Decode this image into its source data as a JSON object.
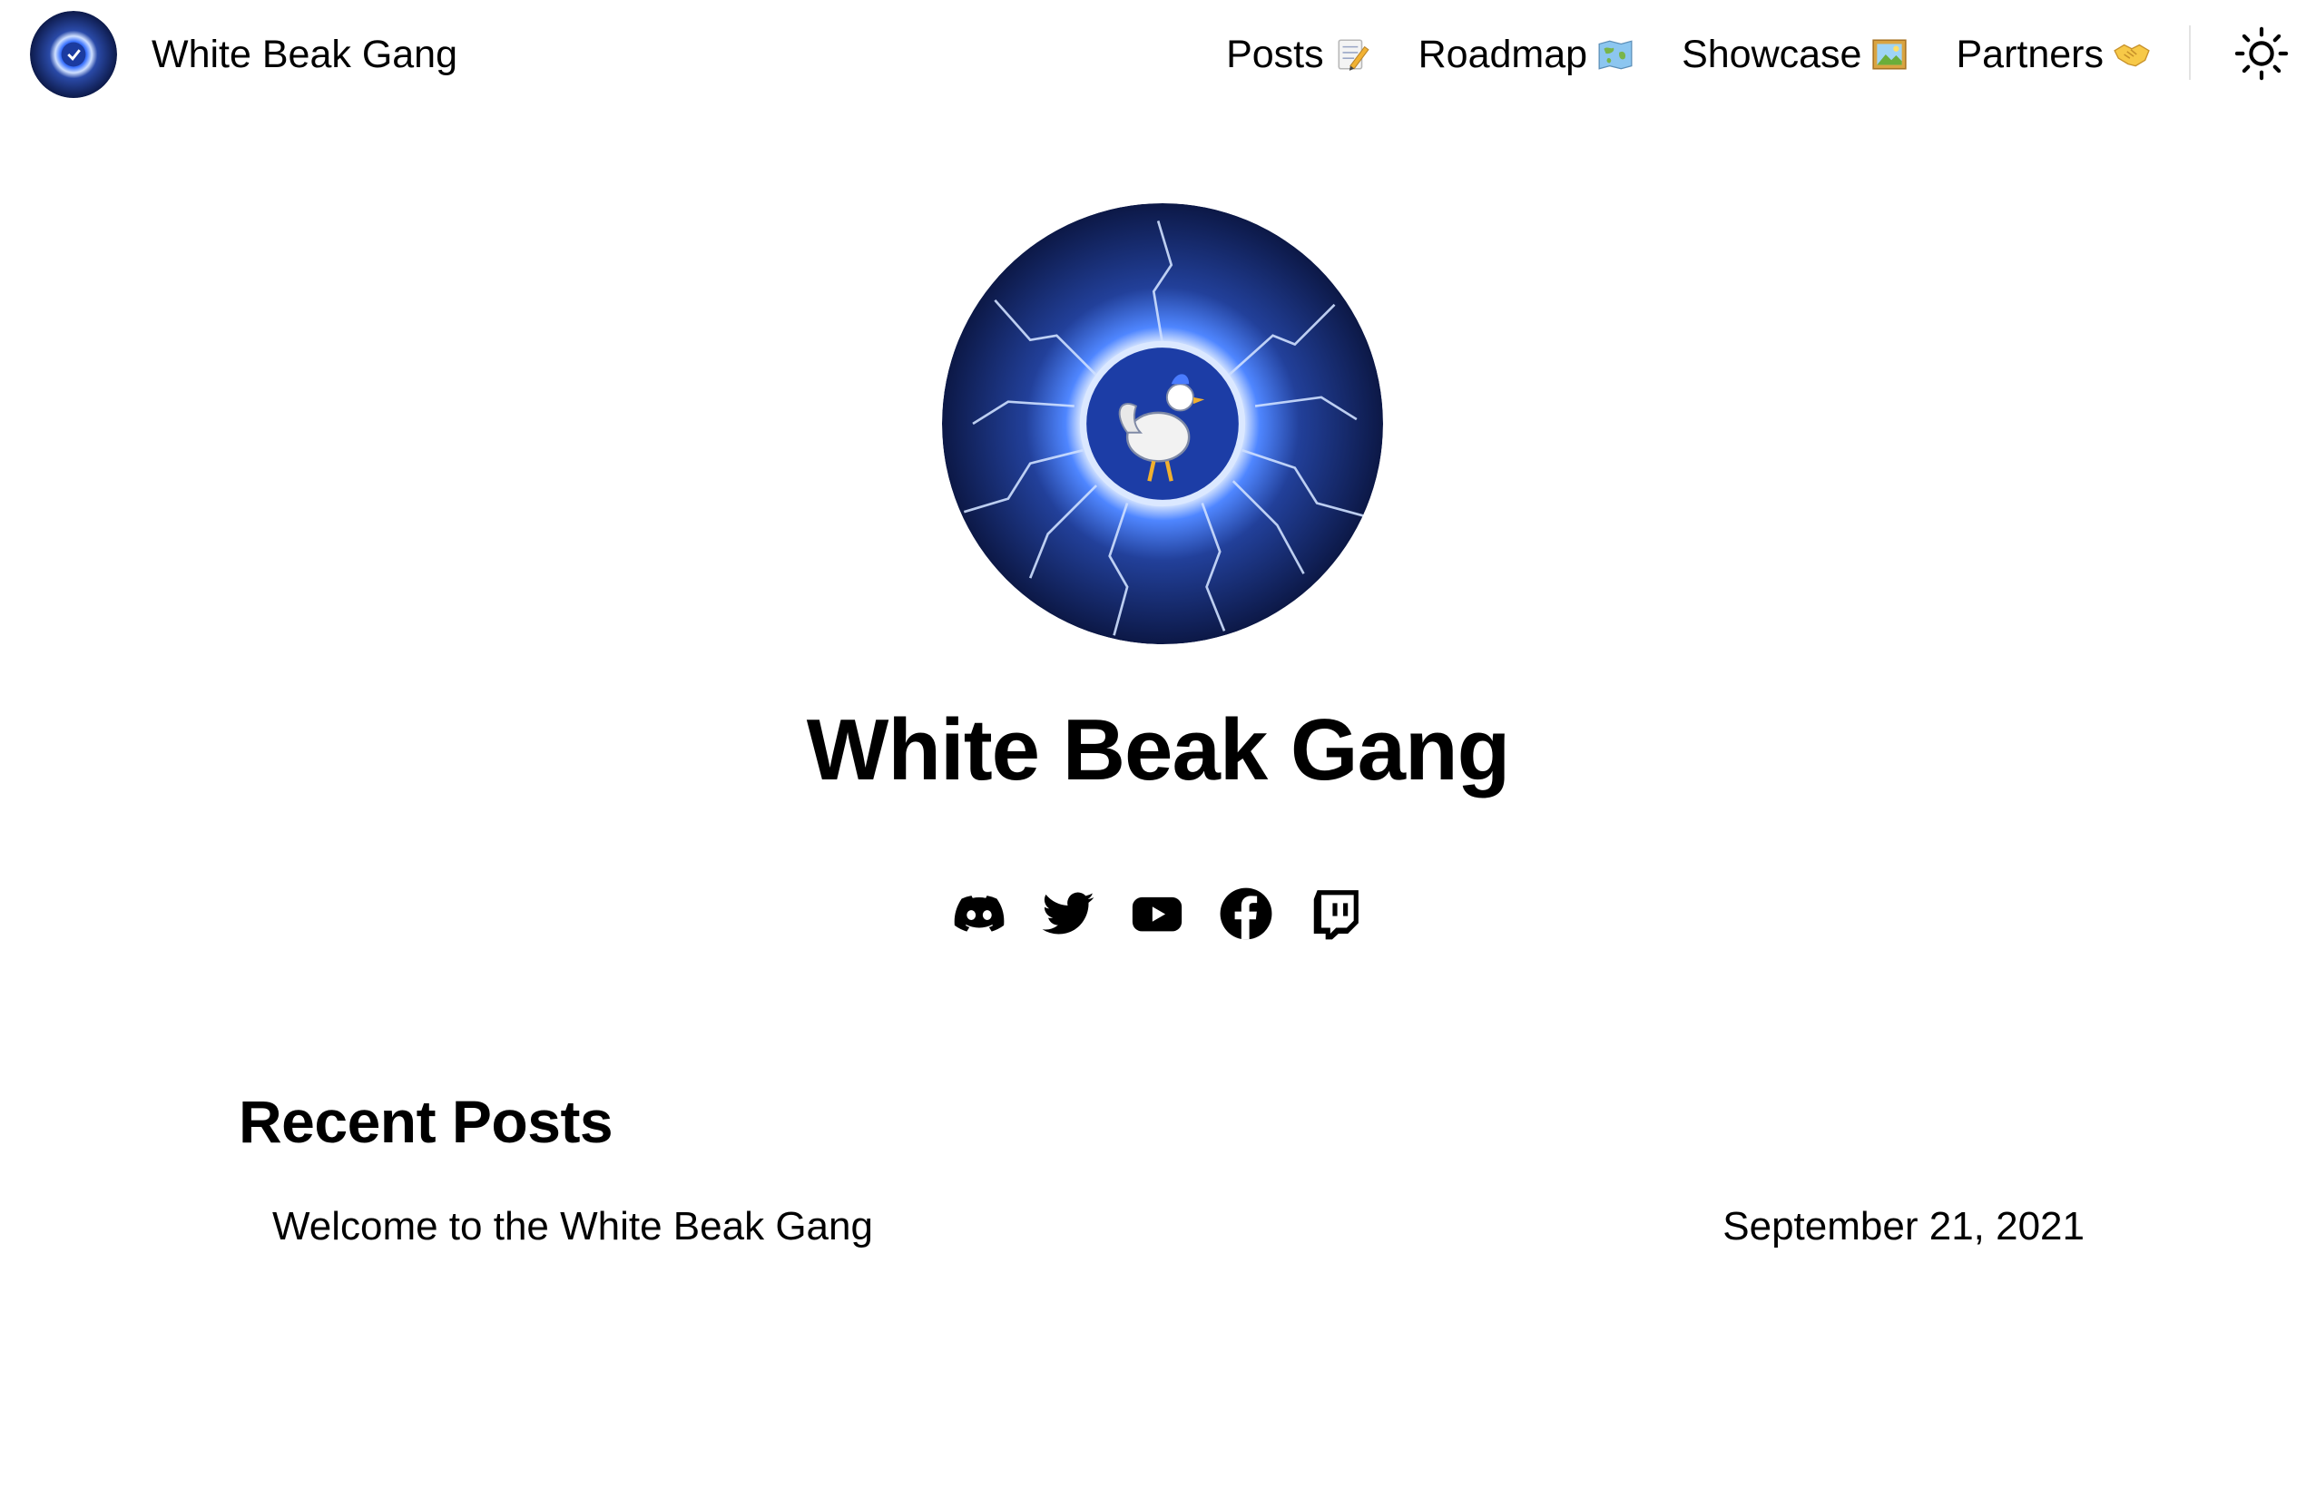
{
  "header": {
    "brand_title": "White Beak Gang",
    "nav": [
      {
        "label": "Posts",
        "icon": "memo-emoji"
      },
      {
        "label": "Roadmap",
        "icon": "world-map-emoji"
      },
      {
        "label": "Showcase",
        "icon": "framed-picture-emoji"
      },
      {
        "label": "Partners",
        "icon": "handshake-emoji"
      }
    ],
    "theme_toggle_icon": "sun-icon"
  },
  "hero": {
    "title": "White Beak Gang",
    "socials": [
      "discord-icon",
      "twitter-icon",
      "youtube-icon",
      "facebook-icon",
      "twitch-icon"
    ]
  },
  "recent_posts": {
    "heading": "Recent Posts",
    "items": [
      {
        "title": "Welcome to the White Beak Gang",
        "date": "September 21, 2021"
      }
    ]
  },
  "colors": {
    "logo_dark_blue": "#0d1a4a",
    "logo_glow": "#3f7cff",
    "text": "#000000",
    "background": "#ffffff"
  }
}
